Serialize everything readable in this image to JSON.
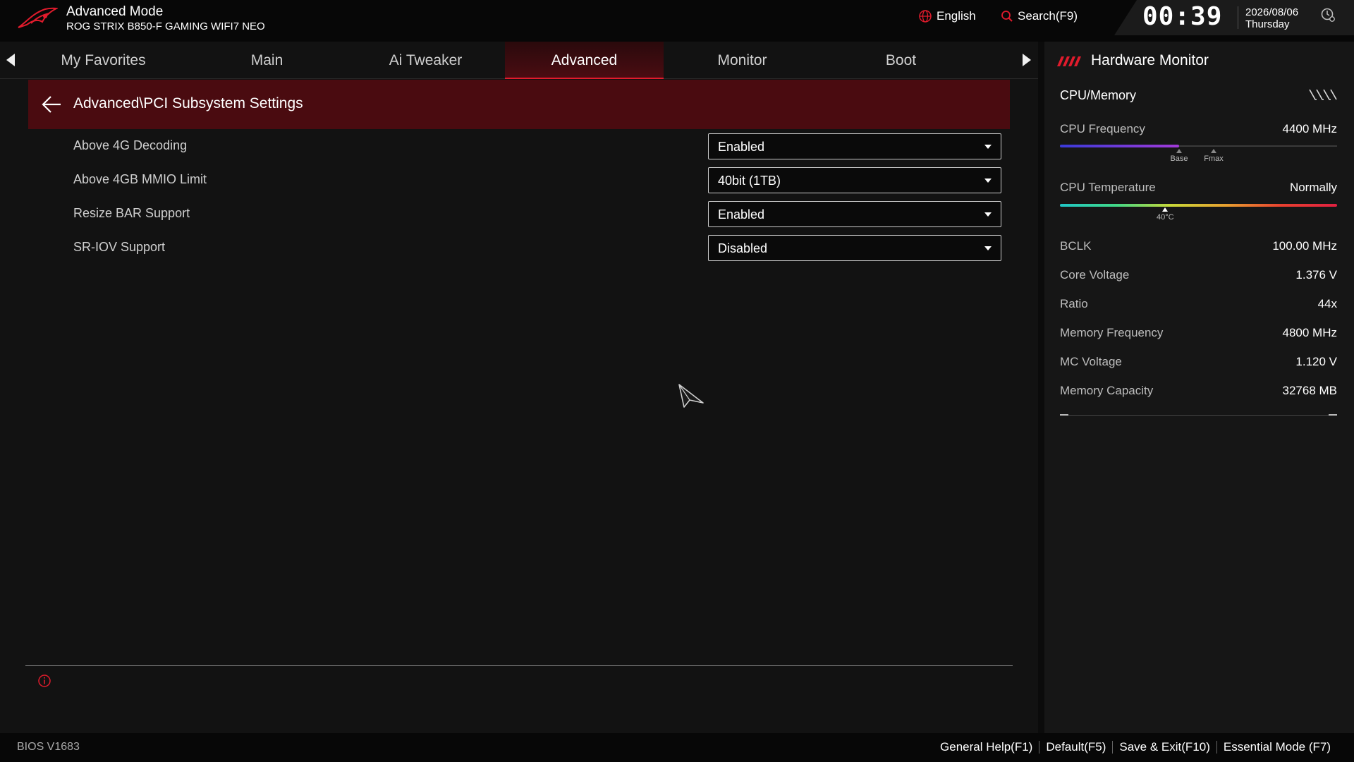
{
  "header": {
    "mode_title": "Advanced Mode",
    "board_name": "ROG STRIX B850-F GAMING WIFI7 NEO",
    "language": "English",
    "search_label": "Search(F9)",
    "time": "00:39",
    "date": "2026/08/06",
    "weekday": "Thursday"
  },
  "tabs": [
    {
      "label": "My Favorites"
    },
    {
      "label": "Main"
    },
    {
      "label": "Ai Tweaker"
    },
    {
      "label": "Advanced"
    },
    {
      "label": "Monitor"
    },
    {
      "label": "Boot"
    }
  ],
  "active_tab": "Advanced",
  "breadcrumb": "Advanced\\PCI Subsystem Settings",
  "settings": [
    {
      "label": "Above 4G Decoding",
      "value": "Enabled"
    },
    {
      "label": "Above 4GB MMIO Limit",
      "value": "40bit (1TB)"
    },
    {
      "label": "Resize BAR Support",
      "value": "Enabled"
    },
    {
      "label": "SR-IOV Support",
      "value": "Disabled"
    }
  ],
  "hardware_monitor": {
    "title": "Hardware Monitor",
    "section": "CPU/Memory",
    "cpu_frequency": {
      "label": "CPU Frequency",
      "value": "4400 MHz",
      "base_label": "Base",
      "fmax_label": "Fmax",
      "fill_fraction": 0.43
    },
    "cpu_temperature": {
      "label": "CPU Temperature",
      "value": "Normally",
      "marker_label": "40°C",
      "marker_fraction": 0.38
    },
    "rows": [
      {
        "label": "BCLK",
        "value": "100.00 MHz"
      },
      {
        "label": "Core Voltage",
        "value": "1.376 V"
      },
      {
        "label": "Ratio",
        "value": "44x"
      },
      {
        "label": "Memory Frequency",
        "value": "4800 MHz"
      },
      {
        "label": "MC Voltage",
        "value": "1.120 V"
      },
      {
        "label": "Memory Capacity",
        "value": "32768 MB"
      }
    ]
  },
  "footer": {
    "bios_version": "BIOS V1683",
    "links": [
      "General Help(F1)",
      "Default(F5)",
      "Save & Exit(F10)",
      "Essential Mode (F7)"
    ]
  },
  "colors": {
    "accent": "#e01b2c",
    "breadcrumb_bg": "#4a0b10",
    "background": "#121212"
  }
}
